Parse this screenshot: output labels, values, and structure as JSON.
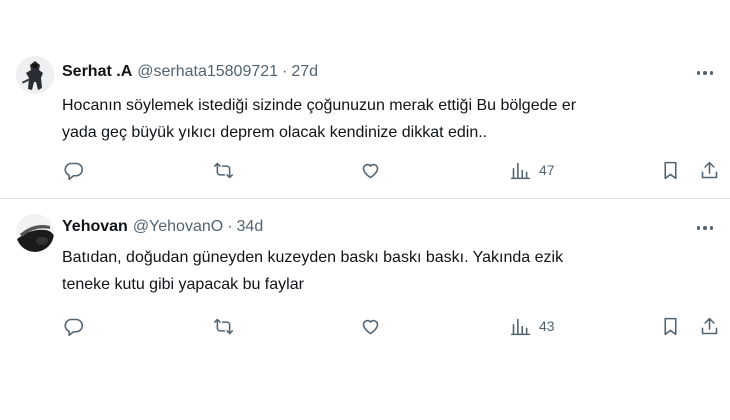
{
  "tweets": [
    {
      "name": "Serhat .A",
      "handle": "@serhata15809721",
      "separator": "·",
      "age": "27d",
      "text_lines": [
        "Hocanın söylemek istediği sizinde çoğunuzun merak ettiği Bu bölgede er",
        "yada geç büyük yıkıcı deprem olacak kendinize dikkat edin.."
      ],
      "views": "47",
      "icons": [
        "reply-icon",
        "retweet-icon",
        "like-icon",
        "views-icon",
        "bookmark-icon",
        "share-icon",
        "more-icon"
      ]
    },
    {
      "name": "Yehovan",
      "handle": "@YehovanO",
      "separator": "·",
      "age": "34d",
      "text_lines": [
        "Batıdan, doğudan güneyden kuzeyden baskı baskı baskı. Yakında ezik",
        "teneke kutu gibi yapacak bu faylar"
      ],
      "views": "43",
      "icons": [
        "reply-icon",
        "retweet-icon",
        "like-icon",
        "views-icon",
        "bookmark-icon",
        "share-icon",
        "more-icon"
      ]
    }
  ],
  "colors": {
    "text": "#0f1419",
    "secondary": "#536471",
    "divider": "#dfe4e8",
    "background": "#ffffff"
  }
}
